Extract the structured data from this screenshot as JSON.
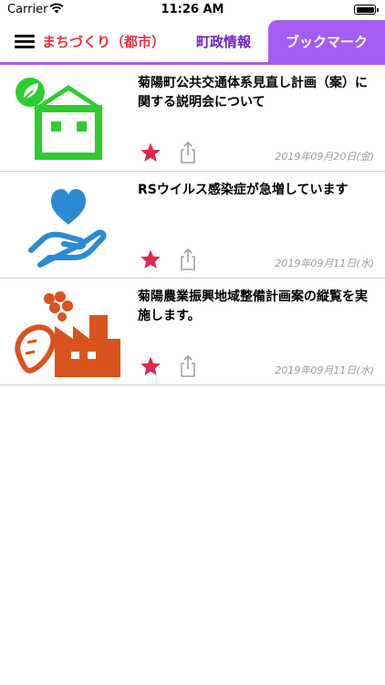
{
  "status_bar": {
    "carrier": "Carrier",
    "time": "11:26 AM"
  },
  "header": {
    "tabs": [
      {
        "label": "まちづくり（都市）",
        "color": "#e83340"
      },
      {
        "label": "町政情報",
        "color": "#6c22c9"
      },
      {
        "label": "ブックマーク",
        "color": "#a55cf2",
        "selected": true
      }
    ]
  },
  "icons": {
    "menu": "hamburger-menu-icon",
    "star": "star-icon",
    "share": "share-icon"
  },
  "articles": [
    {
      "title": "菊陽町公共交通体系見直し計画（案）に関する説明会について",
      "date": "2019年09月20日(金)",
      "thumbnail": "eco-house-icon",
      "bookmarked": true
    },
    {
      "title": "RSウイルス感染症が急増しています",
      "date": "2019年09月11日(水)",
      "thumbnail": "heart-in-hand-icon",
      "bookmarked": true
    },
    {
      "title": "菊陽農業振興地域整備計画案の縦覧を実施します。",
      "date": "2019年09月11日(水)",
      "thumbnail": "carrot-factory-icon",
      "bookmarked": true
    }
  ],
  "colors": {
    "accent": "#a55cf2",
    "star": "#e0284c",
    "house_green": "#2ecc2e",
    "heart_blue": "#2a8ad6",
    "factory_orange": "#d9531e"
  }
}
